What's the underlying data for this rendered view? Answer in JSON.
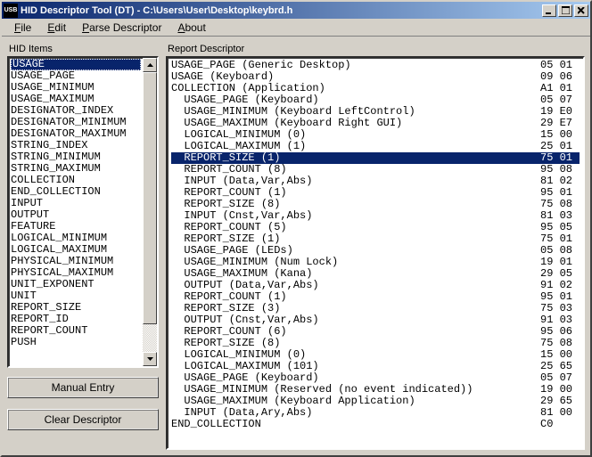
{
  "window": {
    "icon_text": "USB",
    "title": "HID Descriptor Tool (DT) - C:\\Users\\User\\Desktop\\keybrd.h"
  },
  "menu": {
    "file": "File",
    "edit": "Edit",
    "parse": "Parse Descriptor",
    "about": "About"
  },
  "left": {
    "label": "HID Items",
    "items": [
      "USAGE",
      "USAGE_PAGE",
      "USAGE_MINIMUM",
      "USAGE_MAXIMUM",
      "DESIGNATOR_INDEX",
      "DESIGNATOR_MINIMUM",
      "DESIGNATOR_MAXIMUM",
      "STRING_INDEX",
      "STRING_MINIMUM",
      "STRING_MAXIMUM",
      "COLLECTION",
      "END_COLLECTION",
      "INPUT",
      "OUTPUT",
      "FEATURE",
      "LOGICAL_MINIMUM",
      "LOGICAL_MAXIMUM",
      "PHYSICAL_MINIMUM",
      "PHYSICAL_MAXIMUM",
      "UNIT_EXPONENT",
      "UNIT",
      "REPORT_SIZE",
      "REPORT_ID",
      "REPORT_COUNT",
      "PUSH"
    ],
    "selected_index": 0,
    "manual_entry": "Manual Entry",
    "clear_descriptor": "Clear Descriptor"
  },
  "right": {
    "label": "Report Descriptor",
    "rows": [
      {
        "indent": 0,
        "text": "USAGE_PAGE (Generic Desktop)",
        "hex": "05 01"
      },
      {
        "indent": 0,
        "text": "USAGE (Keyboard)",
        "hex": "09 06"
      },
      {
        "indent": 0,
        "text": "COLLECTION (Application)",
        "hex": "A1 01"
      },
      {
        "indent": 1,
        "text": "USAGE_PAGE (Keyboard)",
        "hex": "05 07"
      },
      {
        "indent": 1,
        "text": "USAGE_MINIMUM (Keyboard LeftControl)",
        "hex": "19 E0"
      },
      {
        "indent": 1,
        "text": "USAGE_MAXIMUM (Keyboard Right GUI)",
        "hex": "29 E7"
      },
      {
        "indent": 1,
        "text": "LOGICAL_MINIMUM (0)",
        "hex": "15 00"
      },
      {
        "indent": 1,
        "text": "LOGICAL_MAXIMUM (1)",
        "hex": "25 01"
      },
      {
        "indent": 1,
        "text": "REPORT_SIZE (1)",
        "hex": "75 01",
        "selected": true
      },
      {
        "indent": 1,
        "text": "REPORT_COUNT (8)",
        "hex": "95 08"
      },
      {
        "indent": 1,
        "text": "INPUT (Data,Var,Abs)",
        "hex": "81 02"
      },
      {
        "indent": 1,
        "text": "REPORT_COUNT (1)",
        "hex": "95 01"
      },
      {
        "indent": 1,
        "text": "REPORT_SIZE (8)",
        "hex": "75 08"
      },
      {
        "indent": 1,
        "text": "INPUT (Cnst,Var,Abs)",
        "hex": "81 03"
      },
      {
        "indent": 1,
        "text": "REPORT_COUNT (5)",
        "hex": "95 05"
      },
      {
        "indent": 1,
        "text": "REPORT_SIZE (1)",
        "hex": "75 01"
      },
      {
        "indent": 1,
        "text": "USAGE_PAGE (LEDs)",
        "hex": "05 08"
      },
      {
        "indent": 1,
        "text": "USAGE_MINIMUM (Num Lock)",
        "hex": "19 01"
      },
      {
        "indent": 1,
        "text": "USAGE_MAXIMUM (Kana)",
        "hex": "29 05"
      },
      {
        "indent": 1,
        "text": "OUTPUT (Data,Var,Abs)",
        "hex": "91 02"
      },
      {
        "indent": 1,
        "text": "REPORT_COUNT (1)",
        "hex": "95 01"
      },
      {
        "indent": 1,
        "text": "REPORT_SIZE (3)",
        "hex": "75 03"
      },
      {
        "indent": 1,
        "text": "OUTPUT (Cnst,Var,Abs)",
        "hex": "91 03"
      },
      {
        "indent": 1,
        "text": "REPORT_COUNT (6)",
        "hex": "95 06"
      },
      {
        "indent": 1,
        "text": "REPORT_SIZE (8)",
        "hex": "75 08"
      },
      {
        "indent": 1,
        "text": "LOGICAL_MINIMUM (0)",
        "hex": "15 00"
      },
      {
        "indent": 1,
        "text": "LOGICAL_MAXIMUM (101)",
        "hex": "25 65"
      },
      {
        "indent": 1,
        "text": "USAGE_PAGE (Keyboard)",
        "hex": "05 07"
      },
      {
        "indent": 1,
        "text": "USAGE_MINIMUM (Reserved (no event indicated))",
        "hex": "19 00"
      },
      {
        "indent": 1,
        "text": "USAGE_MAXIMUM (Keyboard Application)",
        "hex": "29 65"
      },
      {
        "indent": 1,
        "text": "INPUT (Data,Ary,Abs)",
        "hex": "81 00"
      },
      {
        "indent": 0,
        "text": "END_COLLECTION",
        "hex": "C0"
      }
    ]
  }
}
